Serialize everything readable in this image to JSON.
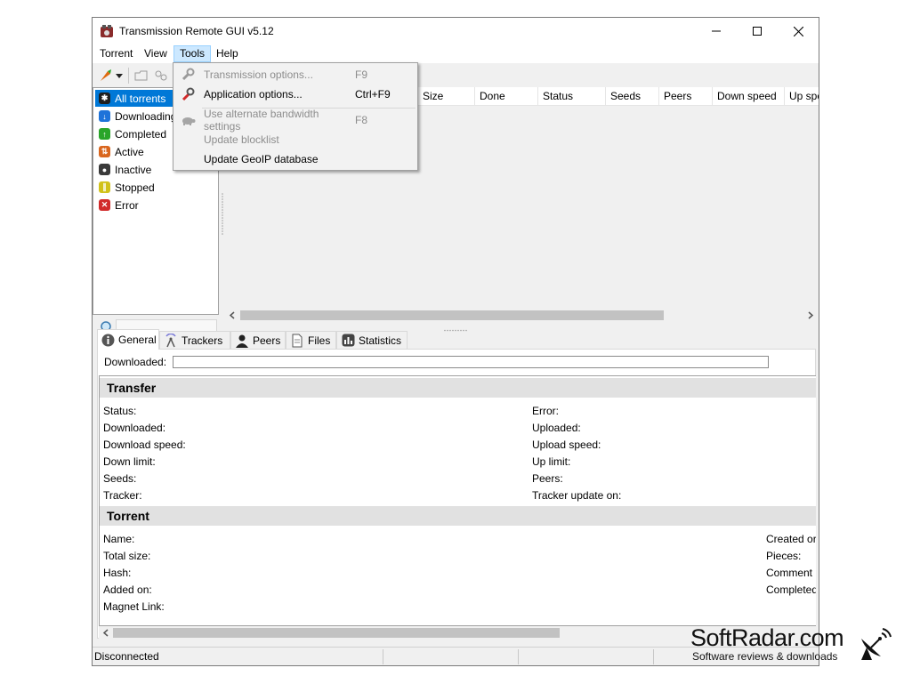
{
  "window": {
    "title": "Transmission Remote GUI v5.12",
    "controls": {
      "minimize": "—",
      "maximize": "☐",
      "close": "✕"
    }
  },
  "menubar": {
    "items": [
      "Torrent",
      "View",
      "Tools",
      "Help"
    ],
    "active": "Tools"
  },
  "tools_menu": {
    "items": [
      {
        "label": "Transmission options...",
        "shortcut": "F9",
        "enabled": false,
        "icon": "wrench-icon"
      },
      {
        "label": "Application options...",
        "shortcut": "Ctrl+F9",
        "enabled": true,
        "icon": "wrench-red-icon"
      },
      {
        "label": "Use alternate bandwidth settings",
        "shortcut": "F8",
        "enabled": false,
        "icon": "turtle-icon"
      },
      {
        "label": "Update blocklist",
        "shortcut": "",
        "enabled": false,
        "icon": ""
      },
      {
        "label": "Update GeoIP database",
        "shortcut": "",
        "enabled": true,
        "icon": ""
      }
    ]
  },
  "sidebar": {
    "items": [
      {
        "label": "All torrents",
        "icon": "asterisk-icon",
        "color": "#1f1f1f",
        "selected": true
      },
      {
        "label": "Downloading",
        "icon": "download-arrow-icon",
        "color": "#1e73d9"
      },
      {
        "label": "Completed",
        "icon": "upload-arrow-icon",
        "color": "#2aa52a"
      },
      {
        "label": "Active",
        "icon": "active-arrows-icon",
        "color": "#d9661e"
      },
      {
        "label": "Inactive",
        "icon": "stop-circle-icon",
        "color": "#3a3a3a"
      },
      {
        "label": "Stopped",
        "icon": "pause-icon",
        "color": "#d1c21a"
      },
      {
        "label": "Error",
        "icon": "error-x-icon",
        "color": "#d12a2a"
      }
    ],
    "filter_placeholder": ""
  },
  "torrent_list": {
    "columns": [
      "Size",
      "Done",
      "Status",
      "Seeds",
      "Peers",
      "Down speed",
      "Up spe"
    ]
  },
  "tabs": [
    "General",
    "Trackers",
    "Peers",
    "Files",
    "Statistics"
  ],
  "general": {
    "downloaded_label": "Downloaded:",
    "transfer": {
      "title": "Transfer",
      "left": [
        "Status:",
        "Downloaded:",
        "Download speed:",
        "Down limit:",
        "Seeds:",
        "Tracker:"
      ],
      "right": [
        "Error:",
        "Uploaded:",
        "Upload speed:",
        "Up limit:",
        "Peers:",
        "Tracker update on:"
      ]
    },
    "torrent": {
      "title": "Torrent",
      "left": [
        "Name:",
        "Total size:",
        "Hash:",
        "Added on:",
        "Magnet Link:"
      ],
      "right": [
        "Created or",
        "Pieces:",
        "Comment",
        "Completed"
      ]
    }
  },
  "statusbar": {
    "text": "Disconnected"
  },
  "watermark": {
    "brand": "SoftRadar.com",
    "tagline": "Software reviews & downloads"
  }
}
